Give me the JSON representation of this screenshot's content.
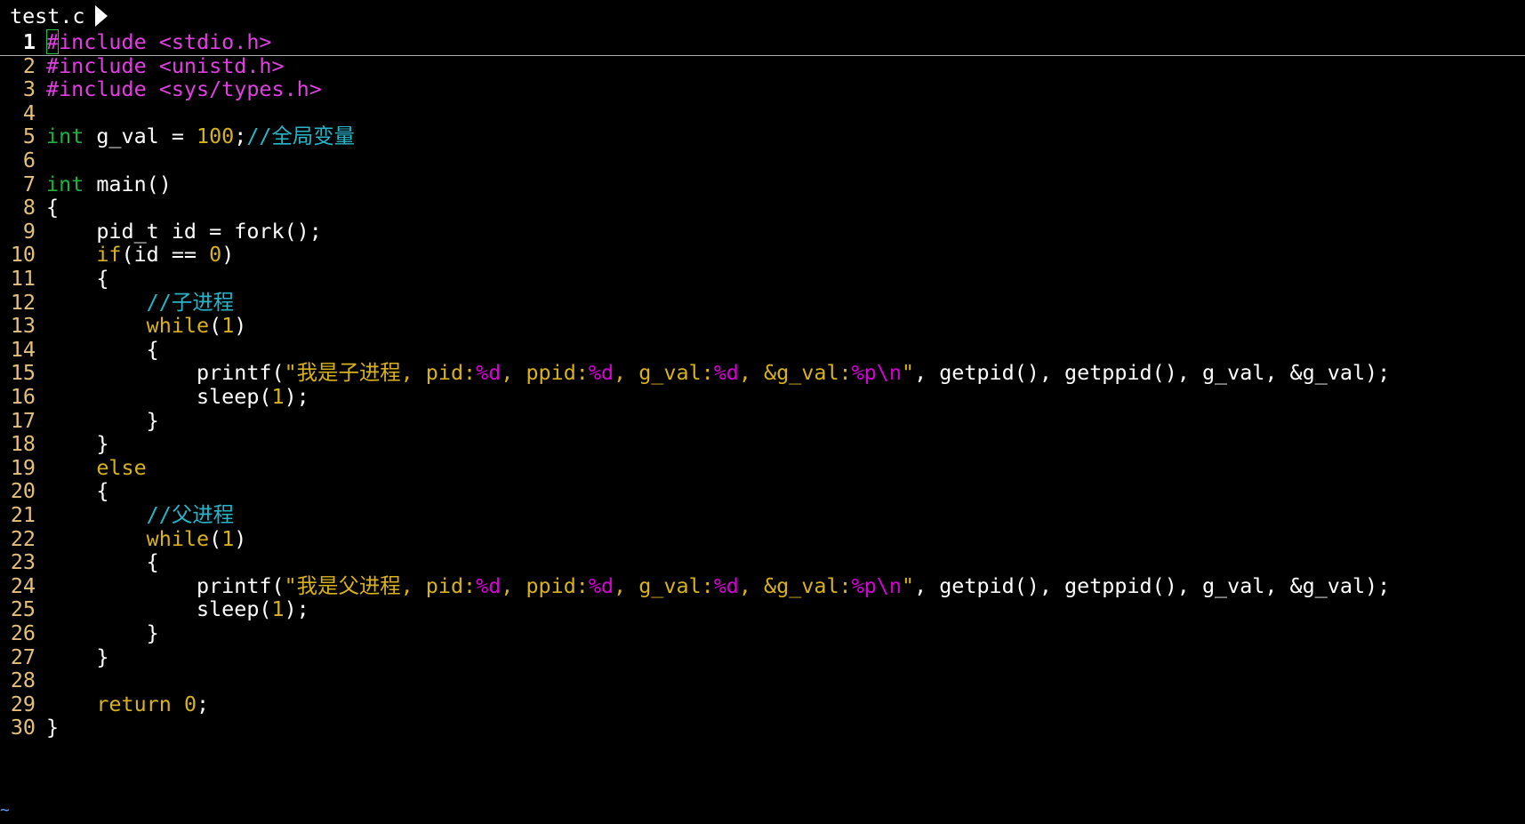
{
  "tab": {
    "title": "test.c"
  },
  "colors": {
    "background": "#000000",
    "preproc": "#e23fe2",
    "type": "#20b040",
    "keyword": "#d8b21a",
    "number": "#d8b21a",
    "comment": "#28b5c8",
    "string": "#d8b21a",
    "format": "#d400d4",
    "line_number": "#e5c07b"
  },
  "editor": {
    "current_line": 1,
    "lines": [
      {
        "n": "1",
        "tokens": [
          [
            "pre",
            "#include <stdio.h>"
          ]
        ]
      },
      {
        "n": "2",
        "tokens": [
          [
            "pre",
            "#include <unistd.h>"
          ]
        ]
      },
      {
        "n": "3",
        "tokens": [
          [
            "pre",
            "#include <sys/types.h>"
          ]
        ]
      },
      {
        "n": "4",
        "tokens": []
      },
      {
        "n": "5",
        "tokens": [
          [
            "type",
            "int"
          ],
          [
            "plain",
            " g_val = "
          ],
          [
            "num",
            "100"
          ],
          [
            "plain",
            ";"
          ],
          [
            "cmt",
            "//全局变量"
          ]
        ]
      },
      {
        "n": "6",
        "tokens": []
      },
      {
        "n": "7",
        "tokens": [
          [
            "type",
            "int"
          ],
          [
            "plain",
            " main()"
          ]
        ]
      },
      {
        "n": "8",
        "tokens": [
          [
            "plain",
            "{"
          ]
        ]
      },
      {
        "n": "9",
        "tokens": [
          [
            "plain",
            "    pid_t id = fork();"
          ]
        ]
      },
      {
        "n": "10",
        "tokens": [
          [
            "plain",
            "    "
          ],
          [
            "kw",
            "if"
          ],
          [
            "plain",
            "(id == "
          ],
          [
            "num",
            "0"
          ],
          [
            "plain",
            ")"
          ]
        ]
      },
      {
        "n": "11",
        "tokens": [
          [
            "plain",
            "    {"
          ]
        ]
      },
      {
        "n": "12",
        "tokens": [
          [
            "plain",
            "        "
          ],
          [
            "cmt",
            "//子进程"
          ]
        ]
      },
      {
        "n": "13",
        "tokens": [
          [
            "plain",
            "        "
          ],
          [
            "kw",
            "while"
          ],
          [
            "plain",
            "("
          ],
          [
            "num",
            "1"
          ],
          [
            "plain",
            ")"
          ]
        ]
      },
      {
        "n": "14",
        "tokens": [
          [
            "plain",
            "        {"
          ]
        ]
      },
      {
        "n": "15",
        "tokens": [
          [
            "plain",
            "            printf("
          ],
          [
            "str",
            "\"我是子进程, pid:"
          ],
          [
            "fmt",
            "%d"
          ],
          [
            "str",
            ", ppid:"
          ],
          [
            "fmt",
            "%d"
          ],
          [
            "str",
            ", g_val:"
          ],
          [
            "fmt",
            "%d"
          ],
          [
            "str",
            ", &g_val:"
          ],
          [
            "fmt",
            "%p\\n"
          ],
          [
            "str",
            "\""
          ],
          [
            "plain",
            ", getpid(), getppid(), g_val, &g_val);"
          ]
        ]
      },
      {
        "n": "16",
        "tokens": [
          [
            "plain",
            "            sleep("
          ],
          [
            "num",
            "1"
          ],
          [
            "plain",
            ");"
          ]
        ]
      },
      {
        "n": "17",
        "tokens": [
          [
            "plain",
            "        }"
          ]
        ]
      },
      {
        "n": "18",
        "tokens": [
          [
            "plain",
            "    }"
          ]
        ]
      },
      {
        "n": "19",
        "tokens": [
          [
            "plain",
            "    "
          ],
          [
            "kw",
            "else"
          ]
        ]
      },
      {
        "n": "20",
        "tokens": [
          [
            "plain",
            "    {"
          ]
        ]
      },
      {
        "n": "21",
        "tokens": [
          [
            "plain",
            "        "
          ],
          [
            "cmt",
            "//父进程"
          ]
        ]
      },
      {
        "n": "22",
        "tokens": [
          [
            "plain",
            "        "
          ],
          [
            "kw",
            "while"
          ],
          [
            "plain",
            "("
          ],
          [
            "num",
            "1"
          ],
          [
            "plain",
            ")"
          ]
        ]
      },
      {
        "n": "23",
        "tokens": [
          [
            "plain",
            "        {"
          ]
        ]
      },
      {
        "n": "24",
        "tokens": [
          [
            "plain",
            "            printf("
          ],
          [
            "str",
            "\"我是父进程, pid:"
          ],
          [
            "fmt",
            "%d"
          ],
          [
            "str",
            ", ppid:"
          ],
          [
            "fmt",
            "%d"
          ],
          [
            "str",
            ", g_val:"
          ],
          [
            "fmt",
            "%d"
          ],
          [
            "str",
            ", &g_val:"
          ],
          [
            "fmt",
            "%p\\n"
          ],
          [
            "str",
            "\""
          ],
          [
            "plain",
            ", getpid(), getppid(), g_val, &g_val);"
          ]
        ]
      },
      {
        "n": "25",
        "tokens": [
          [
            "plain",
            "            sleep("
          ],
          [
            "num",
            "1"
          ],
          [
            "plain",
            ");"
          ]
        ]
      },
      {
        "n": "26",
        "tokens": [
          [
            "plain",
            "        }"
          ]
        ]
      },
      {
        "n": "27",
        "tokens": [
          [
            "plain",
            "    }"
          ]
        ]
      },
      {
        "n": "28",
        "tokens": []
      },
      {
        "n": "29",
        "tokens": [
          [
            "plain",
            "    "
          ],
          [
            "kw",
            "return"
          ],
          [
            "plain",
            " "
          ],
          [
            "num",
            "0"
          ],
          [
            "plain",
            ";"
          ]
        ]
      },
      {
        "n": "30",
        "tokens": [
          [
            "plain",
            "}"
          ]
        ]
      }
    ],
    "empty_marker": "~"
  }
}
